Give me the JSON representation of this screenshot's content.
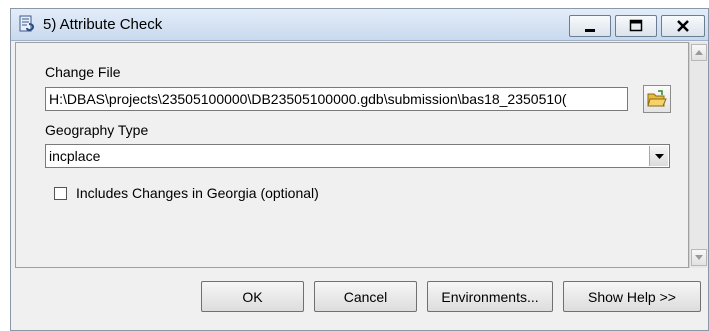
{
  "window": {
    "title": "5) Attribute Check",
    "title_icon": "script-tool-icon"
  },
  "form": {
    "change_file_label": "Change File",
    "change_file_value": "H:\\DBAS\\projects\\23505100000\\DB23505100000.gdb\\submission\\bas18_2350510(",
    "geography_type_label": "Geography Type",
    "geography_type_value": "incplace",
    "georgia_checkbox_label": "Includes Changes in Georgia (optional)",
    "georgia_checked": false
  },
  "buttons": {
    "ok": "OK",
    "cancel": "Cancel",
    "environments": "Environments...",
    "show_help": "Show Help >>"
  },
  "colors": {
    "titlebar": "#c9d9ee",
    "dialog_bg": "#f0f0f0"
  }
}
